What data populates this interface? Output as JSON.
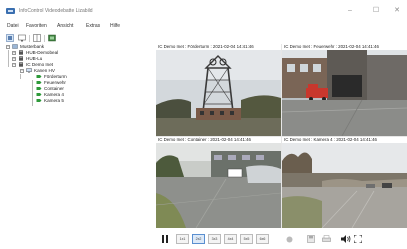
{
  "window": {
    "title": "InfoControl Videodebatte Lizabild",
    "minimize_icon": "minimize-icon",
    "maximize_icon": "maximize-icon",
    "close_icon": "close-icon"
  },
  "menu": [
    "Datei",
    "Favoriten",
    "Ansicht",
    "Extras",
    "Hilfe"
  ],
  "toolbar": {
    "icons": [
      "view-layout-icon",
      "screen-icon",
      "split-view-icon",
      "camera-view-icon"
    ]
  },
  "tree": {
    "items": [
      {
        "label": "Musterbank",
        "level": 0,
        "expander": "−",
        "icon": "database-icon"
      },
      {
        "label": "HUB-Demobeal",
        "level": 1,
        "expander": "+",
        "icon": "server-icon"
      },
      {
        "label": "HUB-Lu",
        "level": 1,
        "expander": "+",
        "icon": "server-icon"
      },
      {
        "label": "IC Demo Inet",
        "level": 1,
        "expander": "−",
        "icon": "server-icon"
      },
      {
        "label": "Kanen HV",
        "level": 2,
        "expander": "−",
        "icon": "monitor-icon"
      },
      {
        "label": "Förderturm",
        "level": 3,
        "expander": "",
        "icon": "camera-icon"
      },
      {
        "label": "Feuerwehr",
        "level": 3,
        "expander": "",
        "icon": "camera-icon"
      },
      {
        "label": "Container",
        "level": 3,
        "expander": "",
        "icon": "camera-icon"
      },
      {
        "label": "Kamera 4",
        "level": 3,
        "expander": "",
        "icon": "camera-icon"
      },
      {
        "label": "Kamera 5",
        "level": 3,
        "expander": "",
        "icon": "camera-icon"
      }
    ]
  },
  "panes": [
    {
      "caption": "IC Demo Inet : Förderturm : 2021-02-04 14:41:46",
      "scene": "tower"
    },
    {
      "caption": "IC Demo Inet : Feuerwehr : 2021-02-04 14:41:46",
      "scene": "firehouse"
    },
    {
      "caption": "IC Demo Inet : Container : 2021-02-04 14:41:46",
      "scene": "container"
    },
    {
      "caption": "IC Demo Inet : Kamera 4 : 2021-02-04 14:41:46",
      "scene": "parking"
    }
  ],
  "controls": {
    "pause_icon": "pause-icon",
    "camera_buttons": [
      "1x1",
      "2x2",
      "3x3",
      "4x4",
      "5x5",
      "6x6"
    ],
    "record_icon": "record-icon",
    "save_icon": "save-icon",
    "print_icon": "print-icon",
    "volume_icon": "volume-icon",
    "fullscreen_icon": "fullscreen-icon"
  },
  "colors": {
    "accent": "#3a6fb0",
    "camera_icon": "#2e9a3a",
    "selected_button": "#dce9f8"
  }
}
